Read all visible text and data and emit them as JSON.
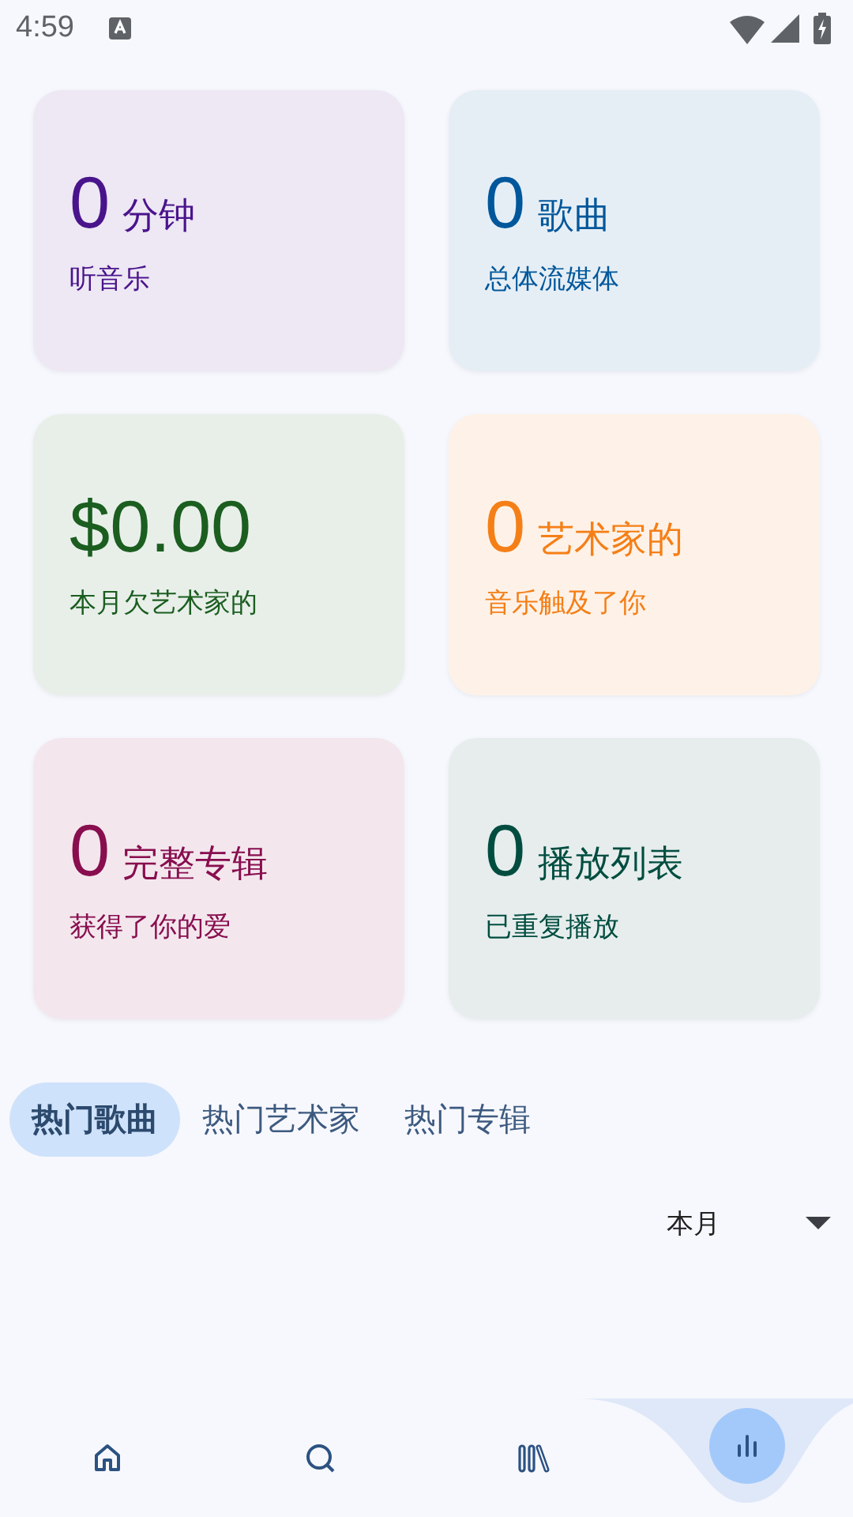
{
  "status_bar": {
    "time": "4:59"
  },
  "stats": [
    {
      "value": "0",
      "unit": "分钟",
      "caption": "听音乐",
      "color": "#4a148c"
    },
    {
      "value": "0",
      "unit": "歌曲",
      "caption": "总体流媒体",
      "color": "#01579b"
    },
    {
      "value": "$0.00",
      "caption": "本月欠艺术家的",
      "color": "#1b5e20"
    },
    {
      "value": "0",
      "unit": "艺术家的",
      "caption": "音乐触及了你",
      "color": "#f57f17"
    },
    {
      "value": "0",
      "unit": "完整专辑",
      "caption": "获得了你的爱",
      "color": "#880e4f"
    },
    {
      "value": "0",
      "unit": "播放列表",
      "caption": "已重复播放",
      "color": "#004d40"
    }
  ],
  "tabs": [
    {
      "label": "热门歌曲",
      "selected": true
    },
    {
      "label": "热门艺术家",
      "selected": false
    },
    {
      "label": "热门专辑",
      "selected": false
    }
  ],
  "period_dropdown": {
    "value": "本月"
  },
  "nav": [
    {
      "kind": "home",
      "selected": false
    },
    {
      "kind": "search",
      "selected": false
    },
    {
      "kind": "library",
      "selected": false
    },
    {
      "kind": "stats",
      "selected": true
    }
  ]
}
